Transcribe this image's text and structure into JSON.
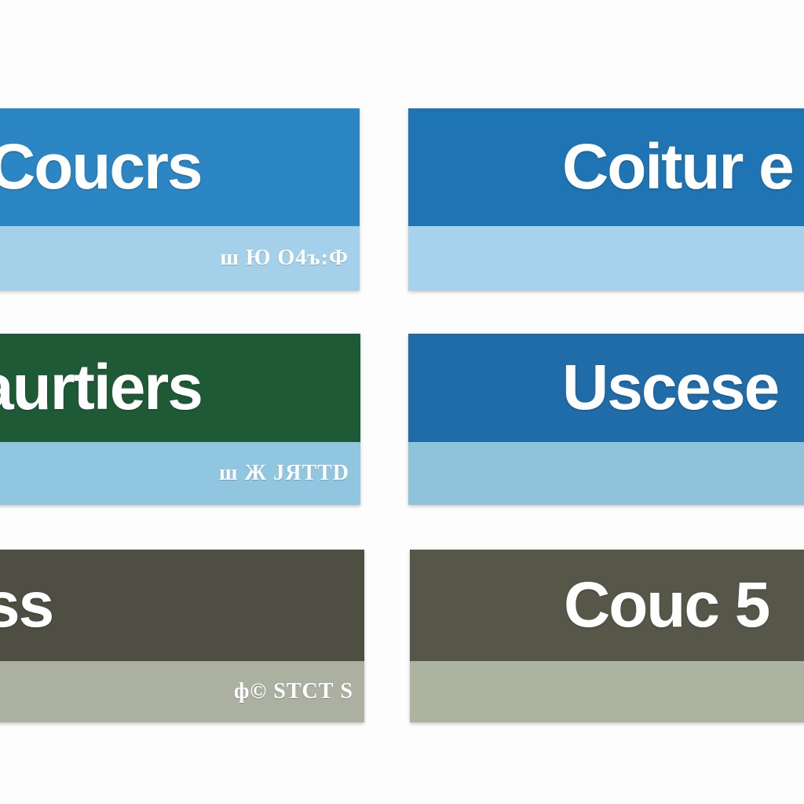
{
  "cards": [
    {
      "title": "Coucrs",
      "subtitle": "ш Ю О4ъ:Ф",
      "top_color": "#2c86c3",
      "bottom_color": "#a5d0ea"
    },
    {
      "title": "Coitur e",
      "subtitle": "",
      "top_color": "#1f74b4",
      "bottom_color": "#a6d2ee"
    },
    {
      "title": "aurtiers",
      "subtitle": "ш Ж JЯТТD",
      "top_color": "#1f5a36",
      "bottom_color": "#90c6e0"
    },
    {
      "title": "Uscese",
      "subtitle": "",
      "top_color": "#206ca8",
      "bottom_color": "#8ec3db"
    },
    {
      "title": "ss",
      "subtitle": "ф© SТCТ S",
      "top_color": "#4f4e43",
      "bottom_color": "#acb0a1"
    },
    {
      "title": "Couc 5",
      "subtitle": "",
      "top_color": "#575749",
      "bottom_color": "#adb3a1"
    }
  ]
}
